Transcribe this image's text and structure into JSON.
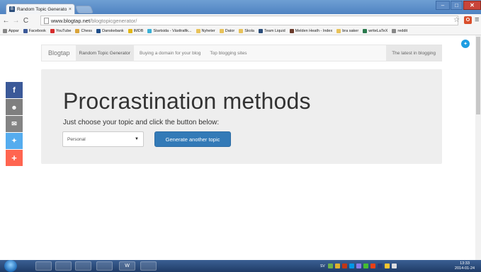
{
  "browser": {
    "tab_title": "Random Topic Generator",
    "tab_close": "×",
    "url_host": "www.blogtap.net",
    "url_path": "/blogtopicgenerator/",
    "bookmarks": [
      {
        "label": "Appar",
        "color": "#888"
      },
      {
        "label": "Facebook",
        "color": "#3b5998"
      },
      {
        "label": "YouTube",
        "color": "#d62b2b"
      },
      {
        "label": "Chess",
        "color": "#d9a43a"
      },
      {
        "label": "Danskebank",
        "color": "#1f4e8a"
      },
      {
        "label": "IMDB",
        "color": "#e2b616"
      },
      {
        "label": "Startsida - Västtrafik...",
        "color": "#3bb0d6"
      },
      {
        "label": "Nyheter",
        "color": "#e8c25a"
      },
      {
        "label": "Dator",
        "color": "#e8c25a"
      },
      {
        "label": "Skola",
        "color": "#e8c25a"
      },
      {
        "label": "Team Liquid",
        "color": "#2a4d7a"
      },
      {
        "label": "Melden Heath - Index",
        "color": "#6b3a2a"
      },
      {
        "label": "bra saker",
        "color": "#e8c25a"
      },
      {
        "label": "writeLaTeX",
        "color": "#2a7a4d"
      },
      {
        "label": "reddit",
        "color": "#888"
      }
    ]
  },
  "navbar": {
    "brand": "Blogtap",
    "links": [
      "Random Topic Generator",
      "Buying a domain for your blog",
      "Top blogging sites"
    ],
    "right_link": "The latest in blogging"
  },
  "hero": {
    "title": "Procrastination methods",
    "lead": "Just choose your topic and click the button below:",
    "select_value": "Personal",
    "button_label": "Generate another topic"
  },
  "share": {
    "facebook": "f",
    "reddit": "☻",
    "email": "✉",
    "twitter": "✦",
    "more": "+"
  },
  "taskbar": {
    "items": [
      "",
      "",
      "",
      "",
      "",
      "W",
      ""
    ],
    "tray_lang": "SV",
    "clock_time": "13:33",
    "clock_date": "2014-01-24"
  },
  "colors": {
    "primary": "#337ab7",
    "facebook": "#3b5998",
    "twitter": "#55acee",
    "plus": "#ff6550"
  }
}
